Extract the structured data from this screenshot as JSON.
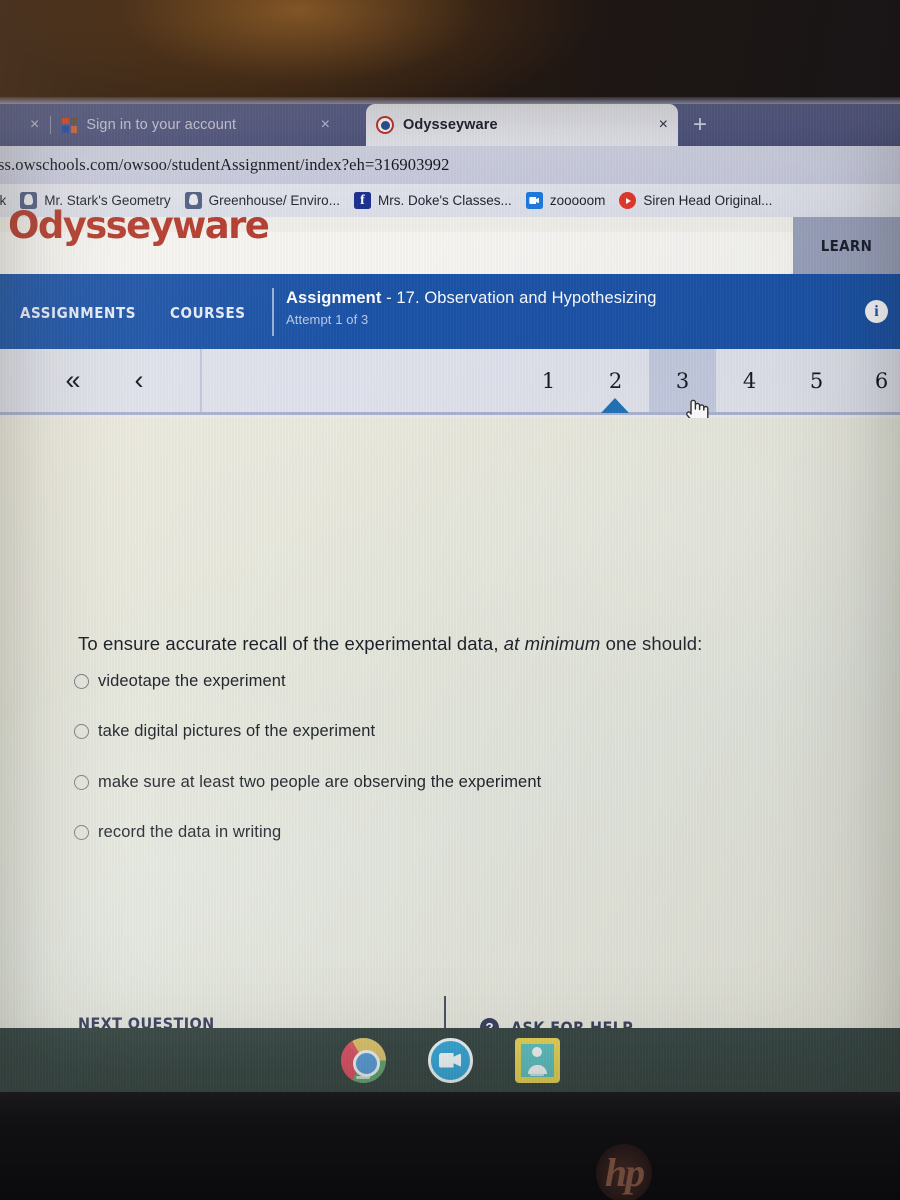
{
  "browser": {
    "tabs": [
      {
        "title": "Sign in to your account",
        "favicon": "microsoft-icon",
        "active": false,
        "close_label": "×"
      },
      {
        "title": "Odysseyware",
        "favicon": "odysseyware-icon",
        "active": true,
        "close_label": "×"
      }
    ],
    "leading_close_label": "×",
    "new_tab_label": "+",
    "url": "ss.owschools.com/owsoo/studentAssignment/index?eh=316903992",
    "bookmarks": [
      {
        "label": "ok",
        "icon": ""
      },
      {
        "label": "Mr. Stark's Geometry",
        "icon": "google-classroom-icon"
      },
      {
        "label": "Greenhouse/ Enviro...",
        "icon": "google-classroom-icon"
      },
      {
        "label": "Mrs. Doke's Classes...",
        "icon": "facebook-icon"
      },
      {
        "label": "zooooom",
        "icon": "zoom-icon"
      },
      {
        "label": "Siren Head Original...",
        "icon": "youtube-icon"
      }
    ]
  },
  "app": {
    "brand": "Odysseyware",
    "brand_color": "#b33a2d",
    "accent_blue": "#1c53a7",
    "learn_tab_label": "LEARN",
    "nav": [
      {
        "label": "ASSIGNMENTS"
      },
      {
        "label": "COURSES"
      }
    ],
    "assignment": {
      "kind_label": "Assignment",
      "title": " - 17. Observation and Hypothesizing",
      "attempt": "Attempt 1 of 3",
      "info_label": "i"
    }
  },
  "pagination": {
    "first_label": "«",
    "prev_label": "‹",
    "numbers": [
      "1",
      "2",
      "3",
      "4",
      "5",
      "6"
    ],
    "current": "2",
    "hovered": "3"
  },
  "question": {
    "stem_before": "To ensure accurate recall of the experimental data, ",
    "stem_italic": "at minimum",
    "stem_after": " one should:",
    "choices": [
      {
        "label": "videotape the experiment",
        "selected": false
      },
      {
        "label": "take digital pictures of the experiment",
        "selected": false
      },
      {
        "label": "make sure at least two people are observing the experiment",
        "selected": false
      },
      {
        "label": "record the data in writing",
        "selected": false
      }
    ]
  },
  "actions": {
    "next_question_label": "NEXT QUESTION",
    "ask_for_help_label": "ASK FOR HELP",
    "help_icon_label": "?"
  },
  "shelf": {
    "items": [
      {
        "name": "chrome-icon"
      },
      {
        "name": "zoom-icon"
      },
      {
        "name": "google-classroom-icon"
      }
    ]
  },
  "device": {
    "brand_mark": "hp"
  }
}
